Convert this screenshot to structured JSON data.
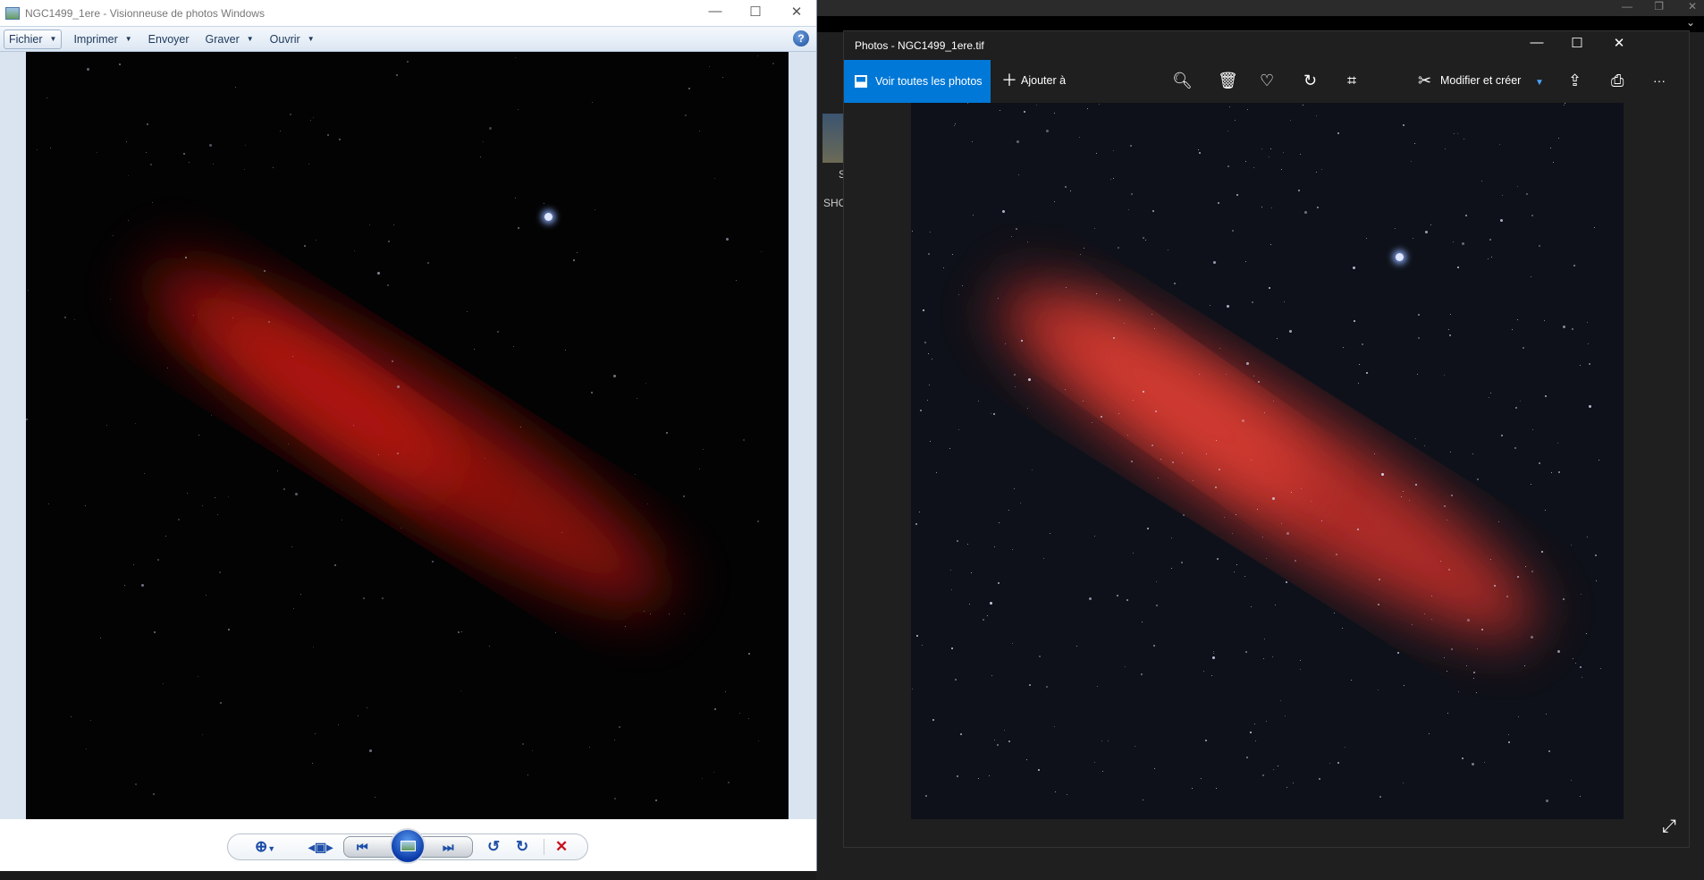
{
  "viewer": {
    "title": "NGC1499_1ere - Visionneuse de photos Windows",
    "menu": [
      {
        "label": "Fichier",
        "dropdown": true
      },
      {
        "label": "Imprimer",
        "dropdown": true
      },
      {
        "label": "Envoyer",
        "dropdown": false
      },
      {
        "label": "Graver",
        "dropdown": true
      },
      {
        "label": "Ouvrir",
        "dropdown": true
      }
    ],
    "help": "?"
  },
  "photos": {
    "title": "Photos - NGC1499_1ere.tif",
    "see_all": "Voir toutes les photos",
    "add_to": "Ajouter à",
    "edit_create": "Modifier et créer",
    "more": "···"
  },
  "background": {
    "label1": "S",
    "label2": "SHC"
  },
  "colors": {
    "accent": "#0078d7",
    "nebula": "#c0201a"
  }
}
